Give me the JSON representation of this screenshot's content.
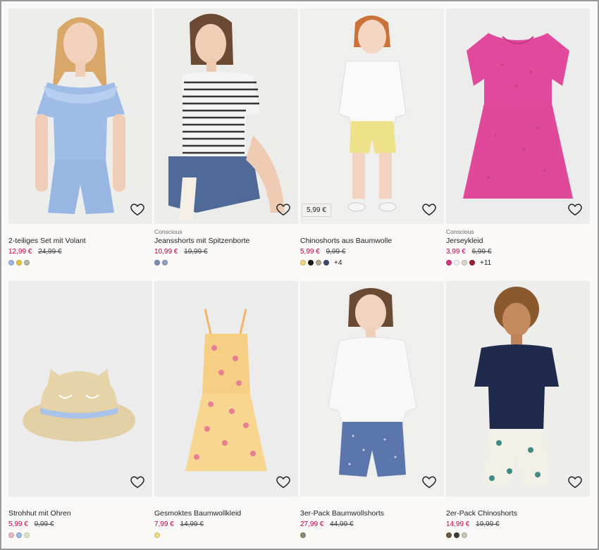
{
  "products": [
    {
      "conscious": "",
      "name": "2-teiliges Set mit Volant",
      "price": "12,99 €",
      "old_price": "24,99 €",
      "price_tag": "",
      "swatches": [
        "#9bb8e0",
        "#e3c43a",
        "#b6b8a4"
      ],
      "more": ""
    },
    {
      "conscious": "Conscious",
      "name": "Jeansshorts mit Spitzenborte",
      "price": "10,99 €",
      "old_price": "19,99 €",
      "price_tag": "",
      "swatches": [
        "#7e8fb2",
        "#8ea2c2"
      ],
      "more": ""
    },
    {
      "conscious": "",
      "name": "Chinoshorts aus Baumwolle",
      "price": "5,99 €",
      "old_price": "9,99 €",
      "price_tag": "5,99 €",
      "swatches": [
        "#ecd77a",
        "#1a1a1a",
        "#b5a98f",
        "#3b4a6b"
      ],
      "more": "+4"
    },
    {
      "conscious": "Conscious",
      "name": "Jerseykleid",
      "price": "3,99 €",
      "old_price": "6,99 €",
      "price_tag": "",
      "swatches": [
        "#d9307f",
        "#f2f2f2",
        "#d9d4c8",
        "#9e1b2f"
      ],
      "more": "+11"
    },
    {
      "conscious": "",
      "name": "Strohhut mit Ohren",
      "price": "5,99 €",
      "old_price": "9,99 €",
      "price_tag": "",
      "swatches": [
        "#e9b8c6",
        "#99b9e0",
        "#d9e3c6"
      ],
      "more": ""
    },
    {
      "conscious": "",
      "name": "Gesmoktes Baumwollkleid",
      "price": "7,99 €",
      "old_price": "14,99 €",
      "price_tag": "",
      "swatches": [
        "#efdc83"
      ],
      "more": ""
    },
    {
      "conscious": "",
      "name": "3er-Pack Baumwollshorts",
      "price": "27,99 €",
      "old_price": "44,99 €",
      "price_tag": "",
      "swatches": [
        "#8a8c6e"
      ],
      "more": ""
    },
    {
      "conscious": "",
      "name": "2er-Pack Chinoshorts",
      "price": "14,99 €",
      "old_price": "19,99 €",
      "price_tag": "",
      "swatches": [
        "#6c5a3c",
        "#3b3b3b",
        "#c9c4b4"
      ],
      "more": ""
    }
  ],
  "icons": {
    "favorite": "heart-outline-icon"
  }
}
